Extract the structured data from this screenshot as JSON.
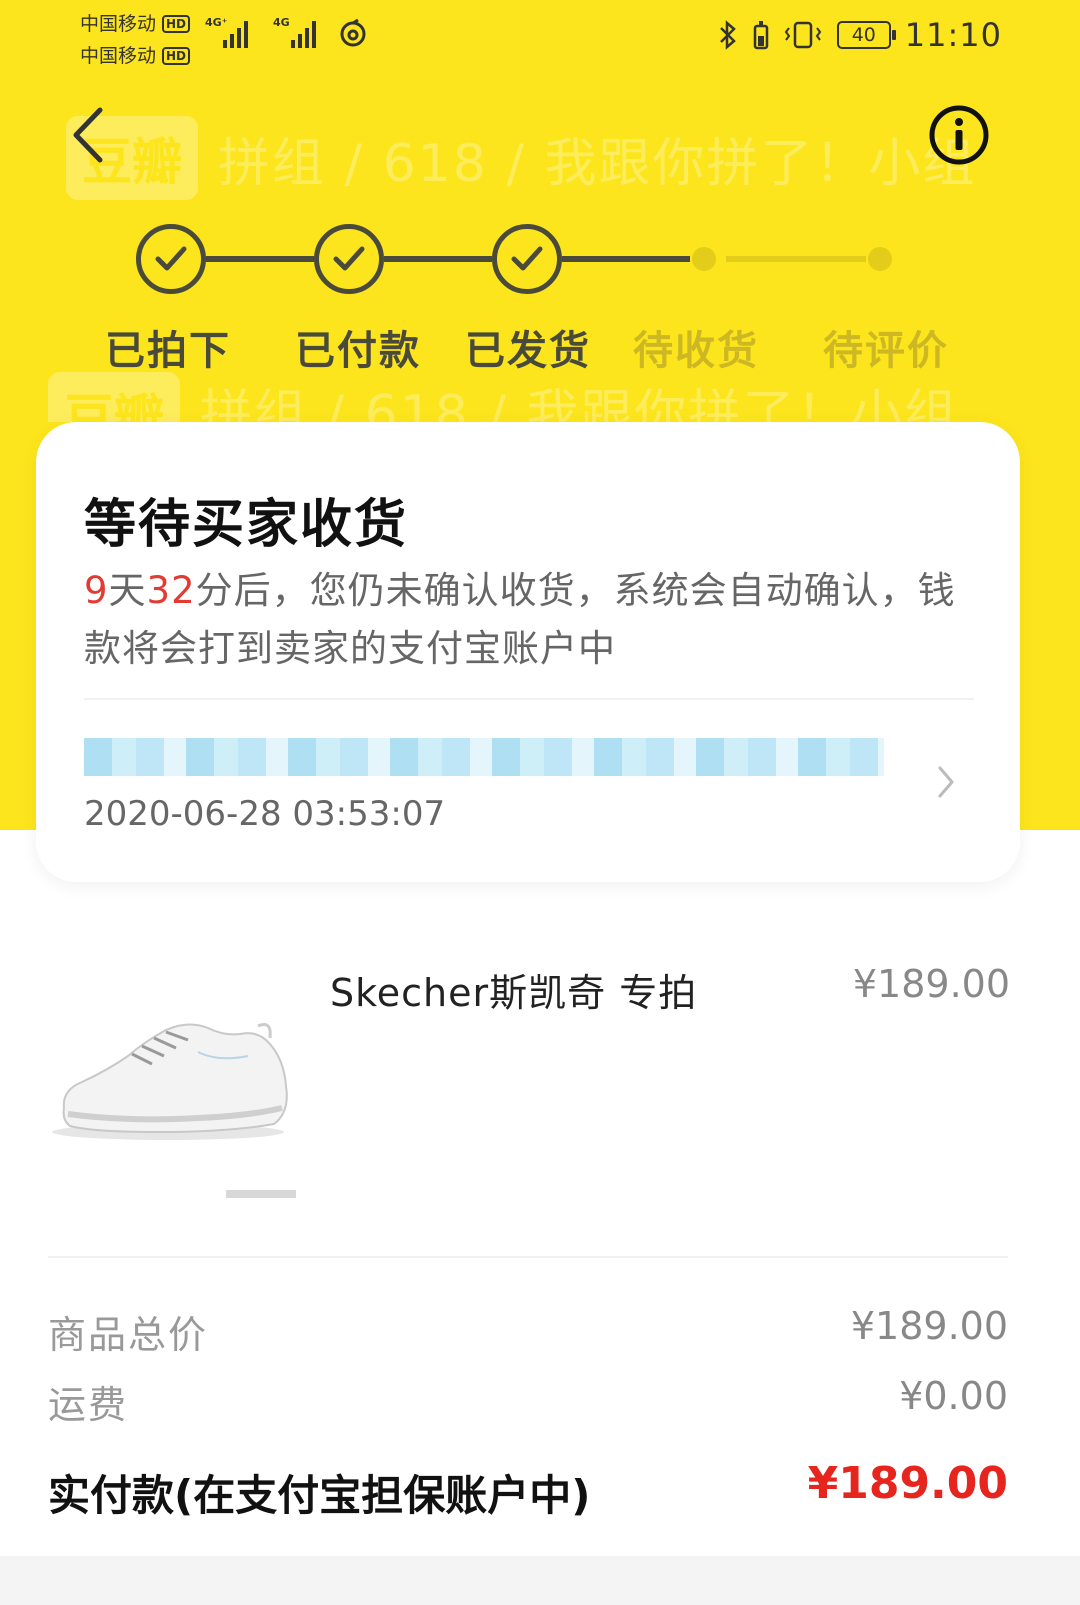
{
  "status_bar": {
    "carrier_1": "中国移动",
    "carrier_2": "中国移动",
    "hd_badge": "HD",
    "network_1": "4G⁺",
    "network_2": "4G",
    "battery": "40",
    "time": "11:10"
  },
  "banner": {
    "logo": "豆瓣",
    "text": "拼组 / 618 / 我跟你拼了！小组"
  },
  "progress": {
    "steps": [
      {
        "label": "已拍下",
        "state": "done"
      },
      {
        "label": "已付款",
        "state": "done"
      },
      {
        "label": "已发货",
        "state": "done"
      },
      {
        "label": "待收货",
        "state": "pending"
      },
      {
        "label": "待评价",
        "state": "pending"
      }
    ]
  },
  "status_card": {
    "title": "等待买家收货",
    "days": "9",
    "days_unit": "天",
    "minutes": "32",
    "desc_rest": "分后，您仍未确认收货，系统会自动确认，钱款将会打到卖家的支付宝账户中",
    "timestamp": "2020-06-28 03:53:07"
  },
  "product": {
    "name": "Skecher斯凯奇 专拍",
    "price": "¥189.00"
  },
  "summary": {
    "goods_total_label": "商品总价",
    "goods_total_value": "¥189.00",
    "shipping_label": "运费",
    "shipping_value": "¥0.00",
    "paid_label": "实付款(在支付宝担保账户中)",
    "paid_value": "¥189.00"
  },
  "colors": {
    "brand_yellow": "#FDE51D",
    "accent_red": "#E7251F",
    "step_dark": "#4A4A3A"
  }
}
